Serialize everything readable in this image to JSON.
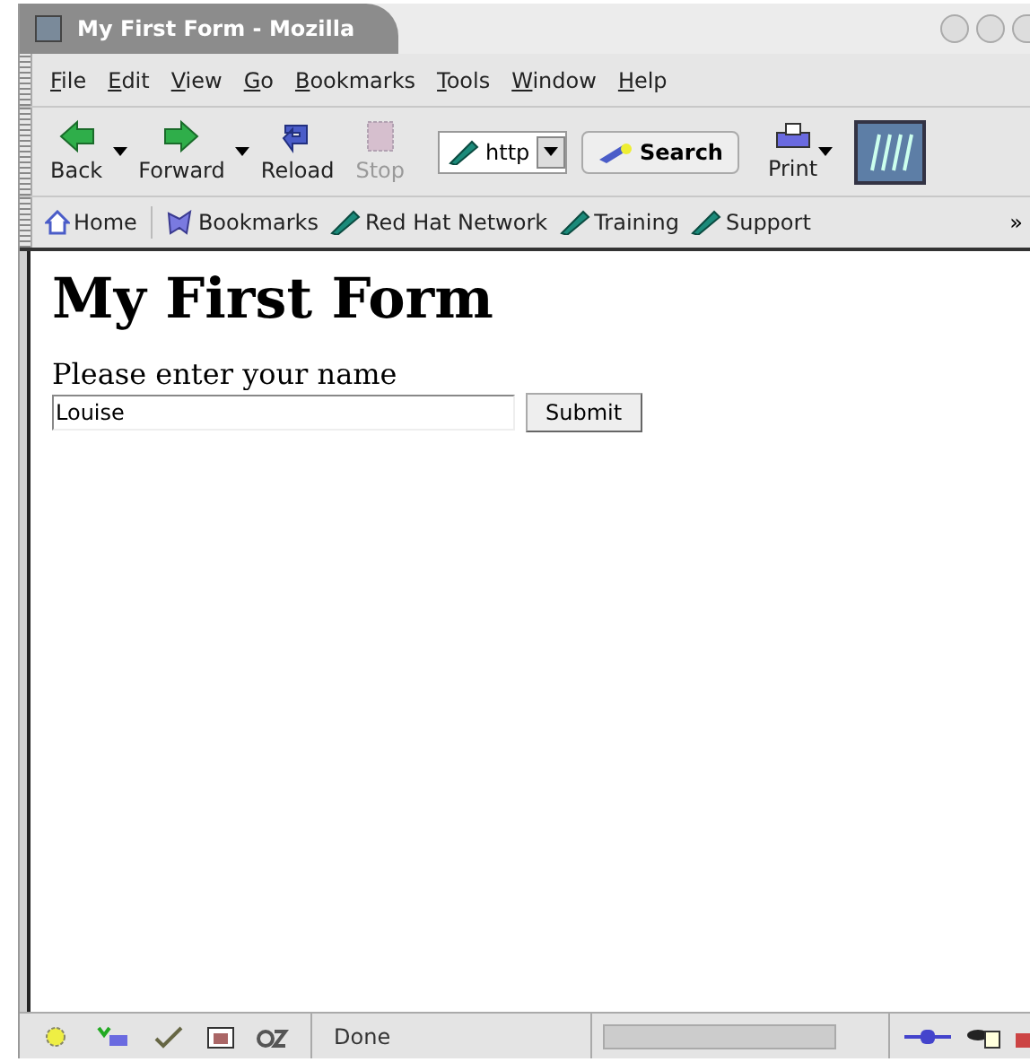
{
  "window": {
    "title": "My First Form - Mozilla"
  },
  "menu": [
    "File",
    "Edit",
    "View",
    "Go",
    "Bookmarks",
    "Tools",
    "Window",
    "Help"
  ],
  "toolbar": [
    {
      "kind": "nav",
      "label": "Back",
      "disabled": false,
      "dropdown": true
    },
    {
      "kind": "nav",
      "label": "Forward",
      "disabled": false,
      "dropdown": true
    },
    {
      "kind": "reload",
      "label": "Reload",
      "disabled": false,
      "dropdown": false
    },
    {
      "kind": "stop",
      "label": "Stop",
      "disabled": true,
      "dropdown": false
    }
  ],
  "url": {
    "value": "http"
  },
  "search_button": "Search",
  "print_button": {
    "label": "Print"
  },
  "personal_bar": [
    {
      "kind": "home",
      "label": "Home"
    },
    {
      "kind": "bookmarks",
      "label": "Bookmarks"
    },
    {
      "kind": "link",
      "label": "Red Hat Network"
    },
    {
      "kind": "link",
      "label": "Training"
    },
    {
      "kind": "link",
      "label": "Support"
    }
  ],
  "overflow": "»",
  "page": {
    "heading": "My First Form",
    "prompt": "Please enter your name",
    "name_value": "Louise",
    "submit": "Submit"
  },
  "status_bar": {
    "text": "Done"
  }
}
